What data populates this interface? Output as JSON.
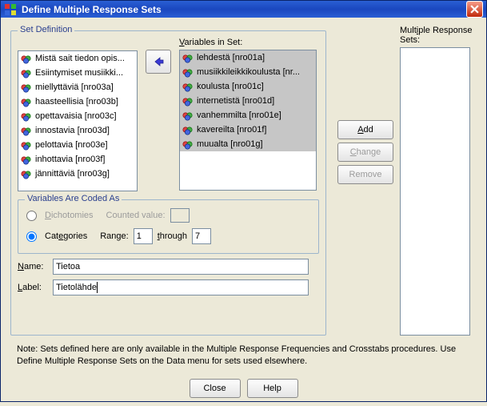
{
  "window": {
    "title": "Define Multiple Response Sets"
  },
  "setdef": {
    "legend": "Set Definition",
    "vars_label": "Variables in Set:",
    "source_items": [
      "Mistä sait tiedon opis...",
      "Esiintymiset musiikki...",
      "miellyttäviä [nro03a]",
      "haasteellisia [nro03b]",
      "opettavaisia [nro03c]",
      "innostavia [nro03d]",
      "pelottavia [nro03e]",
      "inhottavia [nro03f]",
      "jännittäviä [nro03g]"
    ],
    "target_items": [
      "lehdestä [nro01a]",
      "musiikkileikkikoulusta [nr...",
      "koulusta [nro01c]",
      "internetistä [nro01d]",
      "vanhemmilta [nro01e]",
      "kavereilta [nro01f]",
      "muualta [nro01g]"
    ]
  },
  "coded": {
    "legend": "Variables Are Coded As",
    "dichotomies": "Dichotomies",
    "counted": "Counted value:",
    "categories": "Categories",
    "range_label": "Range:",
    "through": "through",
    "range_from": "1",
    "range_to": "7"
  },
  "fields": {
    "name_label": "Name:",
    "label_label": "Label:",
    "name_value": "Tietoa",
    "label_value": "Tietolähde"
  },
  "mrs": {
    "heading": "Multiple Response Sets:",
    "add": "Add",
    "change": "Change",
    "remove": "Remove"
  },
  "note": "Note: Sets defined here are only available in the Multiple Response Frequencies and Crosstabs procedures. Use Define Multiple Response Sets on the Data menu for sets used elsewhere.",
  "buttons": {
    "close": "Close",
    "help": "Help"
  }
}
